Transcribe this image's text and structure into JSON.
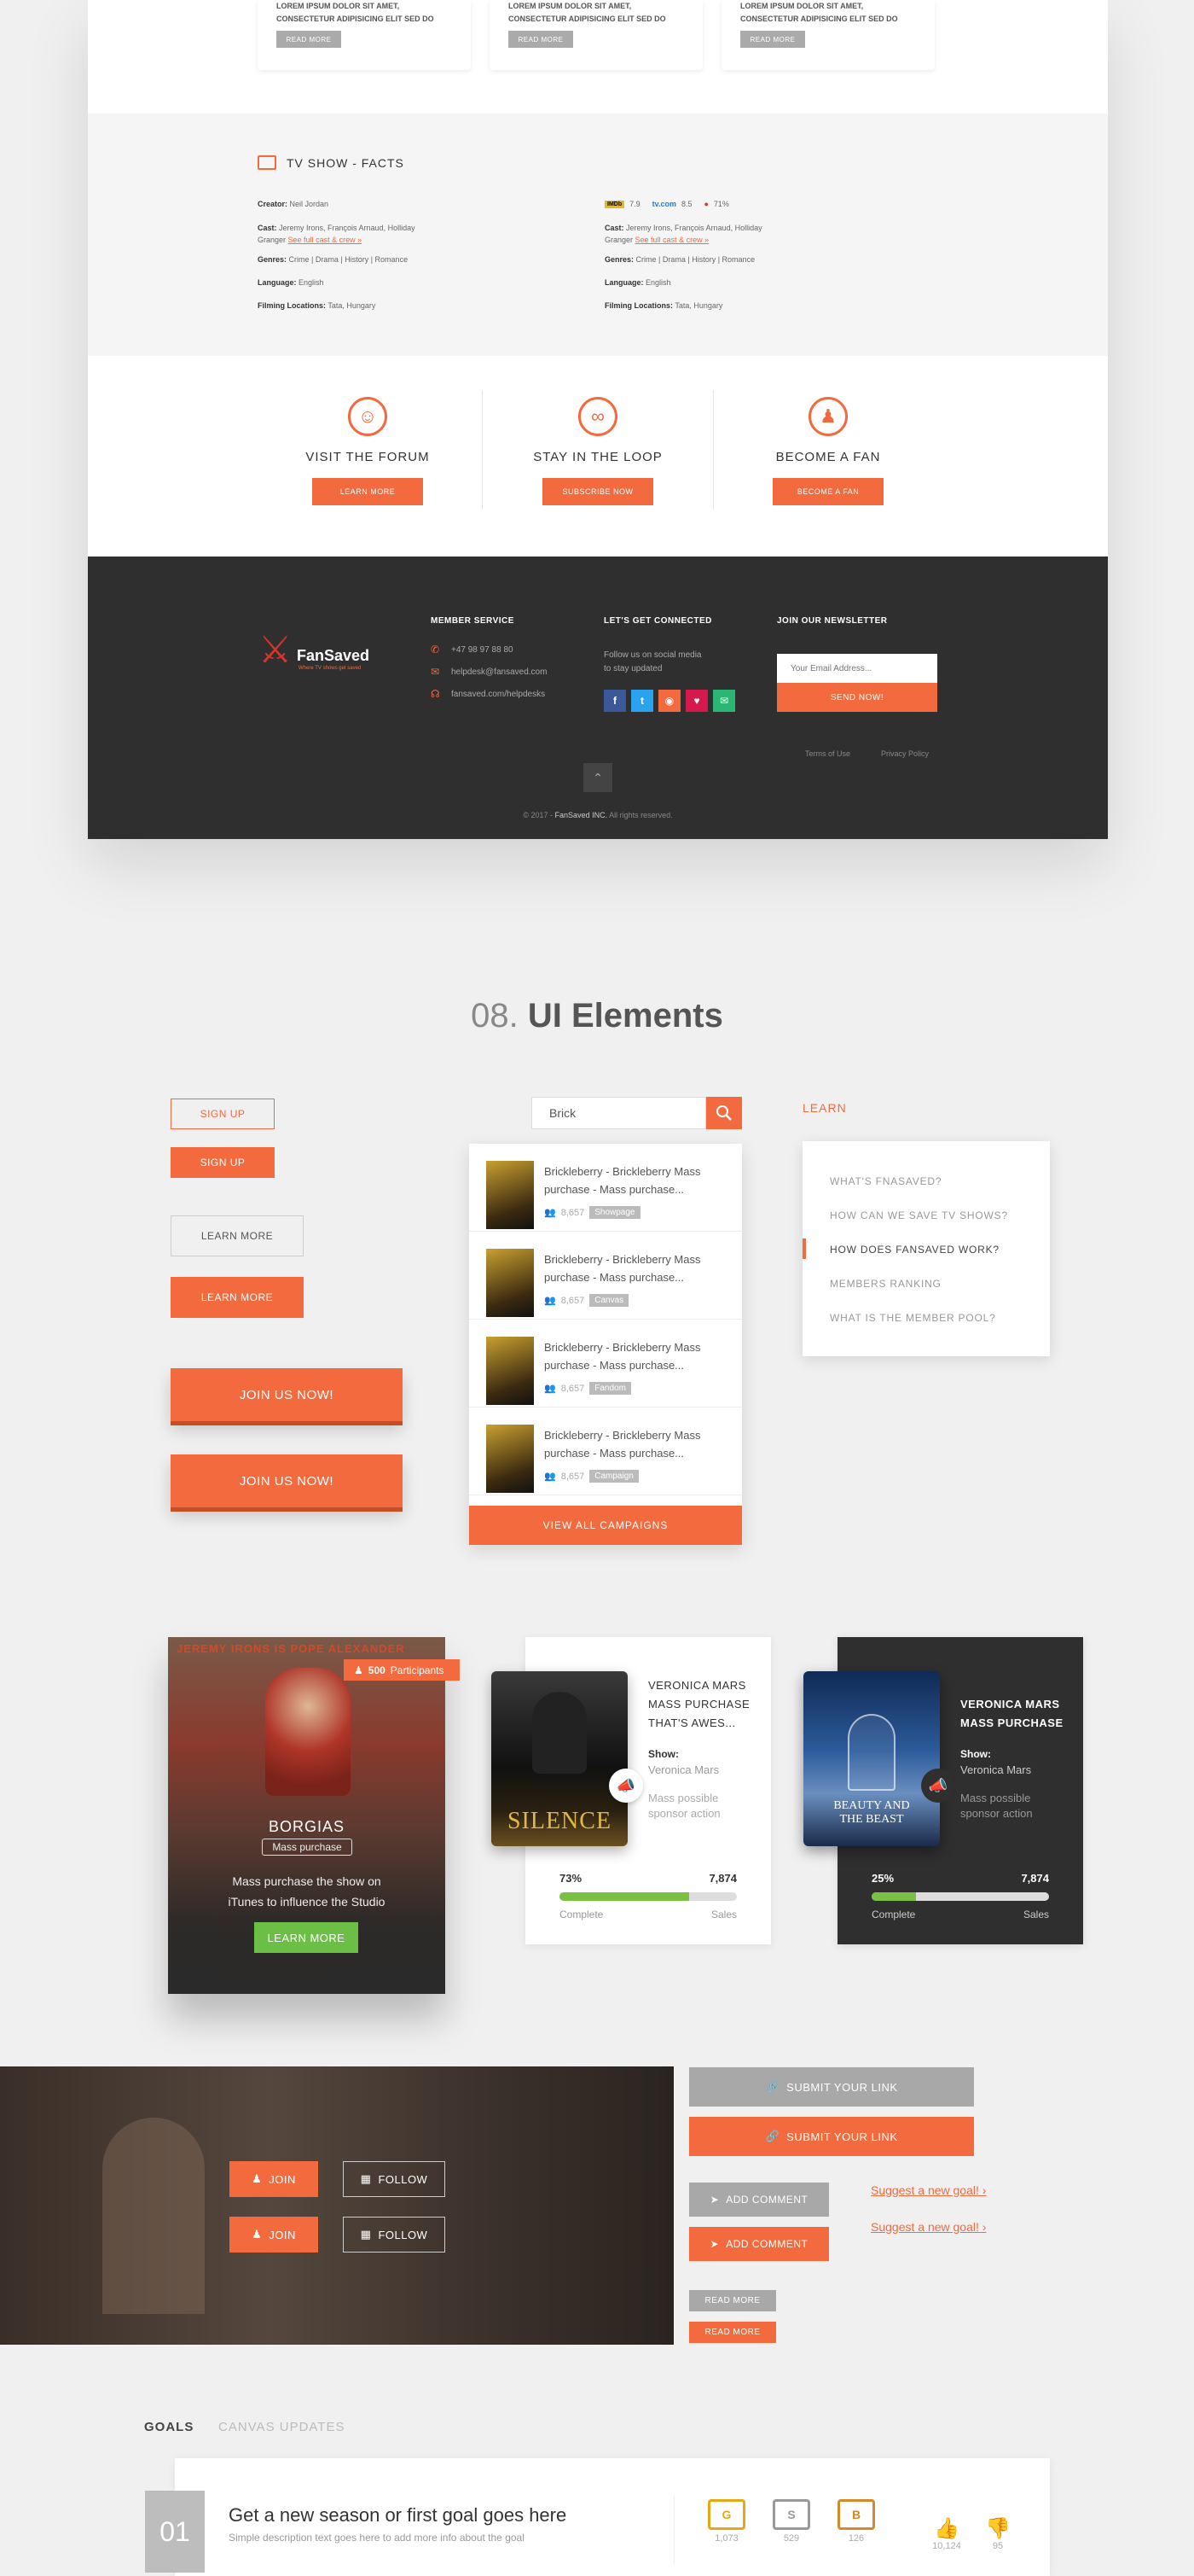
{
  "top_cards": {
    "items": [
      {
        "text": "LOREM IPSUM DOLOR SIT AMET, CONSECTETUR ADIPISICING ELIT SED DO",
        "button": "READ MORE"
      },
      {
        "text": "LOREM IPSUM DOLOR SIT AMET, CONSECTETUR ADIPISICING ELIT SED DO",
        "button": "READ MORE"
      },
      {
        "text": "LOREM IPSUM DOLOR SIT AMET, CONSECTETUR ADIPISICING ELIT SED DO",
        "button": "READ MORE"
      }
    ]
  },
  "facts": {
    "title": "TV SHOW - FACTS",
    "left": {
      "creator_label": "Creator:",
      "creator": "Neil Jordan",
      "cast_label": "Cast:",
      "cast": "Jeremy Irons, François Arnaud, Holliday Granger",
      "cast_link": "See full cast & crew »",
      "genres_label": "Genres:",
      "genres": "Crime | Drama | History | Romance",
      "language_label": "Language:",
      "language": "English",
      "locations_label": "Filming Locations:",
      "locations": "Tata, Hungary"
    },
    "right": {
      "imdb_badge": "IMDb",
      "imdb": "7.9",
      "tvcom_badge": "tv.com",
      "tvcom": "8.5",
      "rt": "71%",
      "cast_label": "Cast:",
      "cast": "Jeremy Irons, François Arnaud, Holliday Granger",
      "cast_link": "See full cast & crew »",
      "genres_label": "Genres:",
      "genres": "Crime | Drama | History | Romance",
      "language_label": "Language:",
      "language": "English",
      "locations_label": "Filming Locations:",
      "locations": "Tata, Hungary"
    }
  },
  "cta": [
    {
      "title": "VISIT THE FORUM",
      "button": "LEARN MORE"
    },
    {
      "title": "STAY IN THE LOOP",
      "button": "SUBSCRIBE NOW"
    },
    {
      "title": "BECOME A FAN",
      "button": "BECOME A FAN"
    }
  ],
  "footer": {
    "logo": "FanSaved",
    "tagline": "Where TV shows get saved",
    "member_title": "MEMBER SERVICE",
    "phone": "+47 98 97 88 80",
    "email": "helpdesk@fansaved.com",
    "help": "fansaved.com/helpdesks",
    "connect_title": "LET'S GET CONNECTED",
    "connect_text_1": "Follow us on social media",
    "connect_text_2": "to stay updated",
    "newsletter_title": "JOIN OUR NEWSLETTER",
    "newsletter_placeholder": "Your Email Address...",
    "newsletter_button": "SEND NOW!",
    "terms": "Terms of Use",
    "privacy": "Privacy Policy",
    "copyright_prefix": "© 2017 - ",
    "copyright_company": "FanSaved INC.",
    "copyright_suffix": " All rights reserved."
  },
  "section": {
    "number": "08.",
    "title": "UI Elements"
  },
  "buttons": {
    "signup_outline": "SIGN UP",
    "signup_filled": "SIGN UP",
    "learn_outline": "LEARN MORE",
    "learn_filled": "LEARN MORE",
    "join_1": "JOIN US NOW!",
    "join_2": "JOIN US NOW!"
  },
  "search": {
    "value": "Brick",
    "results": [
      {
        "title": "Brickleberry - Brickleberry Mass purchase - Mass purchase...",
        "count": "8,657",
        "tag": "Showpage"
      },
      {
        "title": "Brickleberry - Brickleberry Mass purchase - Mass purchase...",
        "count": "8,657",
        "tag": "Canvas"
      },
      {
        "title": "Brickleberry - Brickleberry Mass purchase - Mass purchase...",
        "count": "8,657",
        "tag": "Fandom"
      },
      {
        "title": "Brickleberry - Brickleberry Mass purchase - Mass purchase...",
        "count": "8,657",
        "tag": "Campaign"
      }
    ],
    "view_all": "VIEW ALL CAMPAIGNS"
  },
  "learn_menu": {
    "label": "LEARN",
    "items": [
      "WHAT'S FNASAVED?",
      "HOW CAN WE SAVE TV SHOWS?",
      "HOW DOES FANSAVED WORK?",
      "MEMBERS RANKING",
      "WHAT IS THE MEMBER POOL?"
    ],
    "active_index": 2
  },
  "campaign_cards": {
    "borgias": {
      "banner": "JEREMY IRONS IS POPE ALEXANDER",
      "participants_count": "500",
      "participants_label": "Participants",
      "title": "BORGIAS",
      "subtitle": "Mass purchase",
      "desc": "Mass purchase the show on iTunes to influence the Studio",
      "button": "LEARN MORE"
    },
    "silence": {
      "title": "VERONICA MARS MASS PURCHASE THAT'S AWES...",
      "show_label": "Show:",
      "show": "Veronica Mars",
      "action": "Mass possible sponsor action",
      "poster_text": "SILENCE",
      "percent": "73%",
      "progress": 0.73,
      "sales": "7,874",
      "complete_label": "Complete",
      "sales_label": "Sales"
    },
    "beast": {
      "title": "VERONICA MARS MASS PURCHASE",
      "show_label": "Show:",
      "show": "Veronica Mars",
      "action": "Mass possible sponsor action",
      "poster_text": "BEAUTY AND THE BEAST",
      "percent": "25%",
      "progress": 0.25,
      "sales": "7,874",
      "complete_label": "Complete",
      "sales_label": "Sales"
    }
  },
  "actions": {
    "join": "JOIN",
    "follow": "FOLLOW",
    "submit_link": "SUBMIT YOUR LINK",
    "add_comment": "ADD COMMENT",
    "suggest_goal": "Suggest a new goal!",
    "read_more": "READ MORE"
  },
  "goals": {
    "tab_goals": "GOALS",
    "tab_updates": "CANVAS UPDATES",
    "number": "01",
    "title": "Get a new season or first goal goes here",
    "desc": "Simple description text goes here to add more info about the goal",
    "stats": [
      {
        "icon": "G",
        "value": "1,073"
      },
      {
        "icon": "S",
        "value": "529"
      },
      {
        "icon": "B",
        "value": "126"
      }
    ],
    "likes": "10,124",
    "dislikes": "95"
  }
}
